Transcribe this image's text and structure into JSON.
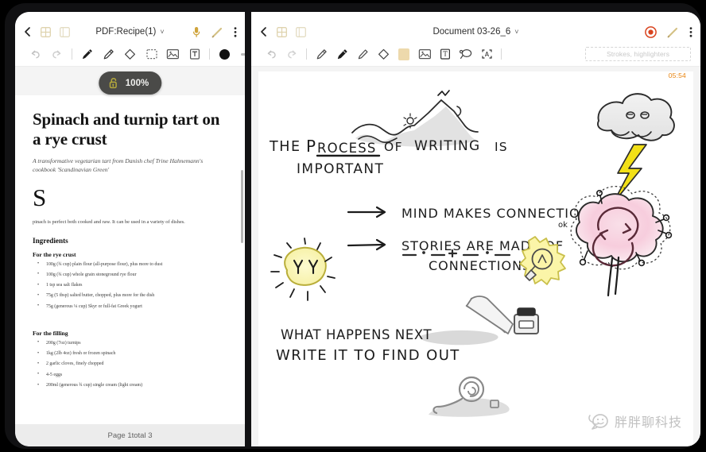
{
  "app": {
    "left_panel": {
      "header": {
        "back_icon": "chevron-left-icon",
        "grid_icon": "grid-view-icon",
        "bookmark_icon": "page-thumbnail-icon",
        "title": "PDF:Recipe(1)",
        "caret": "˅",
        "mic_icon": "microphone-icon",
        "pencil_icon": "pencil-icon",
        "more_icon": "more-vertical-icon"
      },
      "toolbar": {
        "items": [
          {
            "name": "undo-icon",
            "label": "Undo"
          },
          {
            "name": "redo-icon",
            "label": "Redo"
          },
          {
            "name": "pen-icon",
            "label": "Pen"
          },
          {
            "name": "highlighter-icon",
            "label": "Highlighter"
          },
          {
            "name": "eraser-icon",
            "label": "Eraser"
          },
          {
            "name": "lasso-select-icon",
            "label": "Select"
          },
          {
            "name": "image-icon",
            "label": "Insert image"
          },
          {
            "name": "text-box-icon",
            "label": "Text box"
          },
          {
            "name": "color-swatch-black",
            "label": "Black"
          },
          {
            "name": "stroke-width-icon",
            "label": "Stroke width"
          }
        ]
      },
      "zoom_badge": {
        "lock_icon": "unlock-icon",
        "percent": "100%"
      },
      "document": {
        "title": "Spinach and turnip tart on a rye crust",
        "subtitle": "A transformative vegetarian tart from Danish chef Trine Hahnemann's cookbook 'Scandinavian Green'",
        "dropcap": "S",
        "paragraph": "pinach is perfect both cooked and raw. It can be used in a variety of dishes.",
        "section_heading": "Ingredients",
        "groups": [
          {
            "heading": "For the rye crust",
            "items": [
              "100g (¾ cup) plain flour (all-purpose flour), plus more to dust",
              "100g (¾ cup) whole grain stoneground rye flour",
              "1 tsp sea salt flakes",
              "75g (5 tbsp) salted butter, chopped, plus more for the dish",
              "75g (generous ¼ cup) Skyr or full-fat Greek yogurt"
            ]
          },
          {
            "heading": "For the filling",
            "items": [
              "200g (7oz) turnips",
              "1kg (2lb 4oz) fresh or frozen spinach",
              "2 garlic cloves, finely chopped",
              "4-5 eggs",
              "200ml (generous ¾ cup) single cream (light cream)"
            ]
          }
        ]
      },
      "footer": {
        "page_status": "Page 1total 3"
      }
    },
    "right_panel": {
      "header": {
        "back_icon": "chevron-left-icon",
        "grid_icon": "grid-view-icon",
        "bookmark_icon": "page-thumbnail-icon",
        "title": "Document 03-26_6",
        "caret": "˅",
        "record_icon": "record-button-icon",
        "pencil_icon": "pencil-icon",
        "more_icon": "more-vertical-icon"
      },
      "toolbar": {
        "items": [
          {
            "name": "undo-icon",
            "label": "Undo"
          },
          {
            "name": "redo-icon",
            "label": "Redo"
          },
          {
            "name": "pencil-tool-icon",
            "label": "Pencil"
          },
          {
            "name": "pen-tool-icon",
            "label": "Pen"
          },
          {
            "name": "highlighter-icon",
            "label": "Highlighter"
          },
          {
            "name": "eraser-icon",
            "label": "Eraser"
          },
          {
            "name": "color-swatch-tan",
            "label": "Tan"
          },
          {
            "name": "image-icon",
            "label": "Insert image"
          },
          {
            "name": "text-box-icon",
            "label": "Text box"
          },
          {
            "name": "lasso-select-icon",
            "label": "Lasso"
          },
          {
            "name": "text-recognition-icon",
            "label": "Text recognition"
          }
        ],
        "strokes_placeholder": "Strokes, highlighters"
      },
      "canvas": {
        "timestamp": "05:54",
        "handwriting": {
          "line1": "THE PROCESS OF WRITING IS",
          "line2": "IMPORTANT",
          "bullet1": "MIND MAKES CONNECTIONS",
          "bullet2_line1": "STORIES ARE MADE OF",
          "bullet2_line2": "CONNECTIONS",
          "footer_line1": "WHAT HAPPENS NEXT",
          "footer_line2": "WRITE IT TO FIND OUT",
          "brain_label": "ok"
        },
        "sketches": [
          {
            "name": "mountain-landscape-sketch"
          },
          {
            "name": "rain-cloud-sketch"
          },
          {
            "name": "lightning-bolt-sketch"
          },
          {
            "name": "pink-brain-cloud-sketch"
          },
          {
            "name": "sun-face-sketch"
          },
          {
            "name": "lightbulb-sketch"
          },
          {
            "name": "fountain-pen-inkwell-sketch"
          },
          {
            "name": "snail-sketch"
          }
        ]
      }
    },
    "watermark": {
      "text": "胖胖聊科技",
      "icon": "speech-bubble-icon"
    },
    "colors": {
      "accent_tan": "#d9c79a",
      "record_red": "#d9441f",
      "timestamp_orange": "#e8820c",
      "lightning_yellow": "#f2e017",
      "brain_pink": "#f6c6d8",
      "sun_yellow": "#f5f0a0"
    }
  }
}
